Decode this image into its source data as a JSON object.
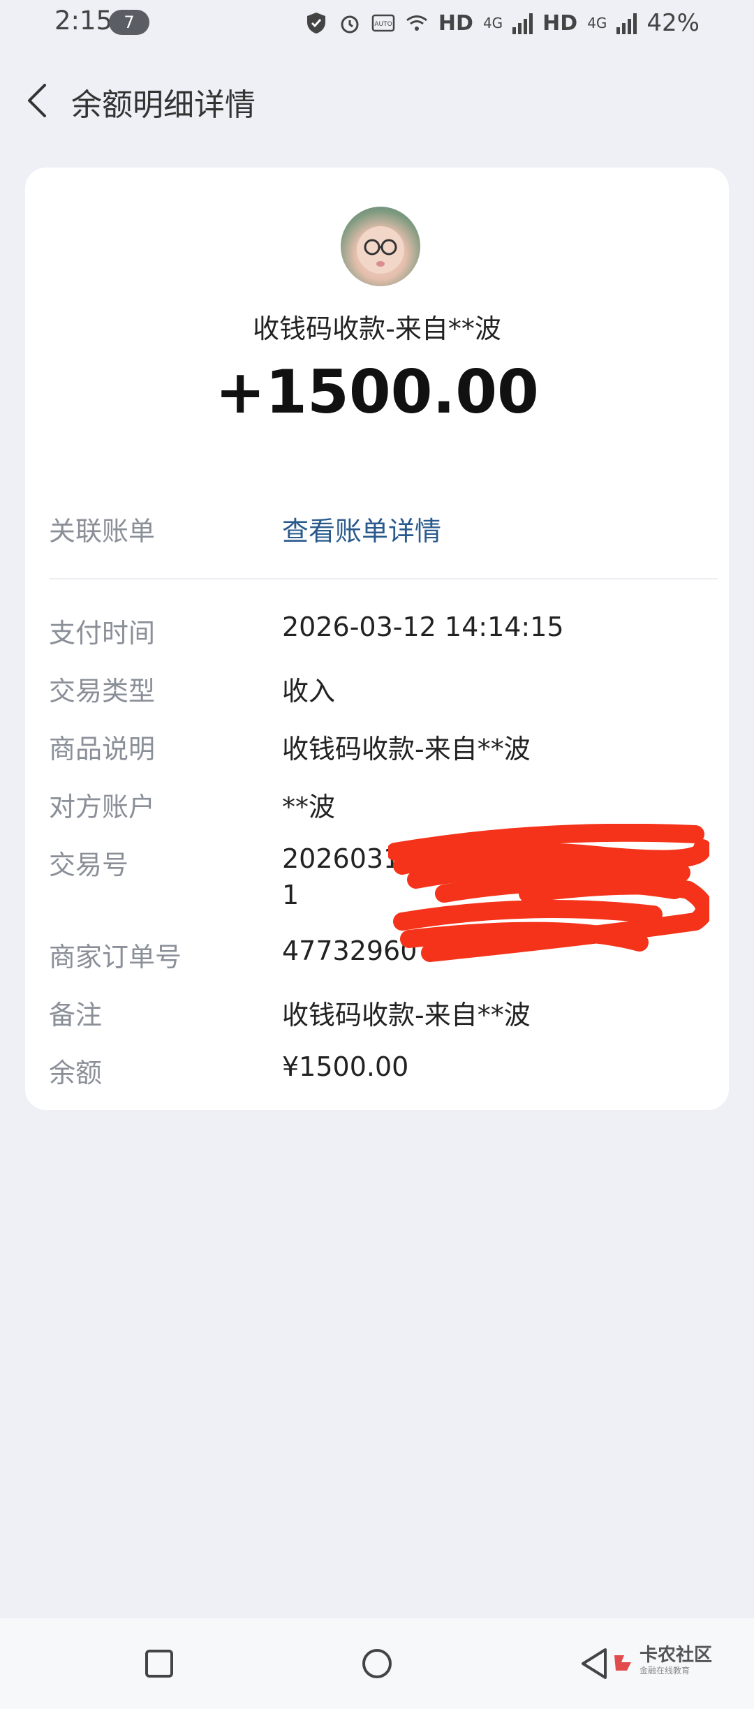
{
  "status_bar": {
    "time": "2:15",
    "notif_count": "7",
    "hd1": "HD",
    "net1": "4G",
    "hd2": "HD",
    "net2": "4G",
    "battery": "42%"
  },
  "header": {
    "title": "余额明细详情"
  },
  "transaction": {
    "title": "收钱码收款-来自**波",
    "amount": "+1500.00"
  },
  "related": {
    "label": "关联账单",
    "value": "查看账单详情"
  },
  "details": [
    {
      "label": "支付时间",
      "value": "2026-03-12 14:14:15"
    },
    {
      "label": "交易类型",
      "value": "收入"
    },
    {
      "label": "商品说明",
      "value": "收钱码收款-来自**波"
    },
    {
      "label": "对方账户",
      "value": "**波"
    },
    {
      "label": "交易号",
      "value": "20260312220"
    },
    {
      "label": "商家订单号",
      "value": "47732960"
    },
    {
      "label": "备注",
      "value": "收钱码收款-来自**波"
    },
    {
      "label": "余额",
      "value": "¥1500.00"
    }
  ],
  "txn_id_line2": "1",
  "watermark": {
    "text": "卡农社区",
    "sub": "金融在线教育"
  },
  "colors": {
    "background": "#eef0f6",
    "link": "#2a5a8c",
    "scribble": "#f4331a"
  }
}
